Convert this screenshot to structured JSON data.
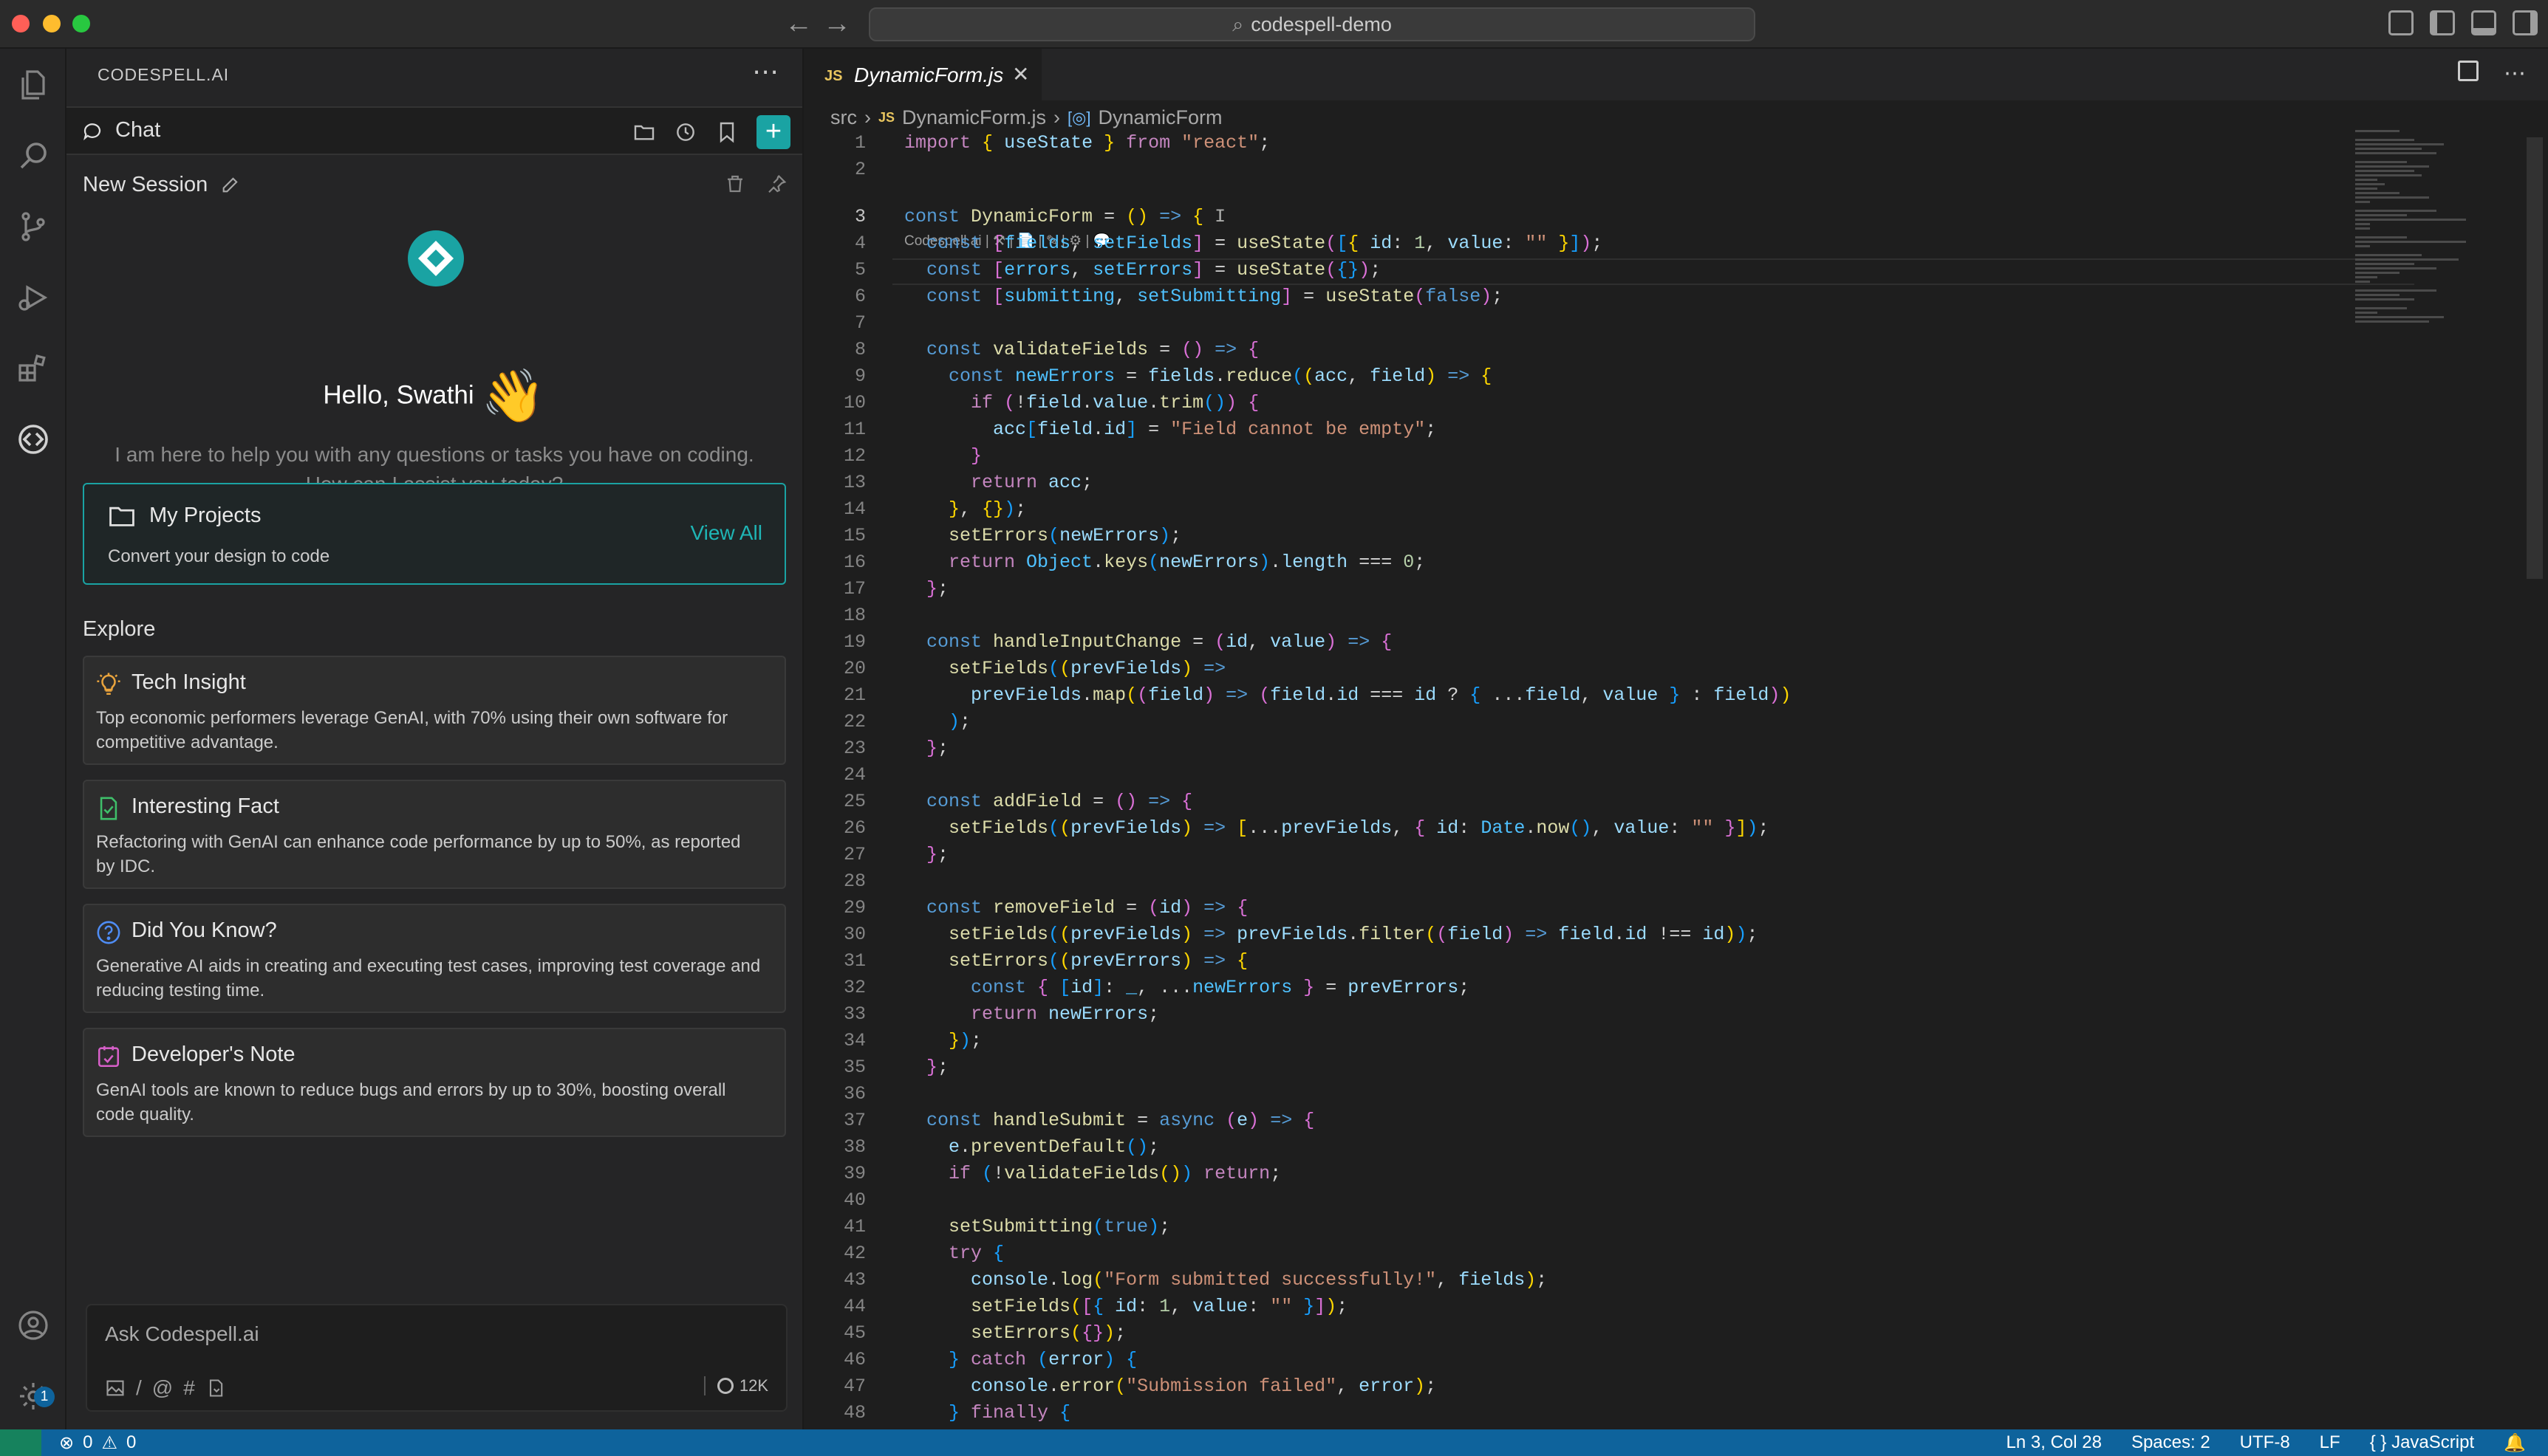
{
  "titlebar": {
    "search": "codespell-demo"
  },
  "sidebar": {
    "header": "CODESPELL.AI",
    "chat_label": "Chat",
    "session_title": "New Session",
    "greeting": "Hello, Swathi",
    "wave": "👋",
    "intro": "I am here to help you with any questions or tasks you have on coding. How can I assist you today?",
    "projects": {
      "title": "My Projects",
      "subtitle": "Convert your design to code",
      "view_all": "View All"
    },
    "explore_label": "Explore",
    "cards": [
      {
        "title": "Tech Insight",
        "body": "Top economic performers leverage GenAI, with 70% using their own software for competitive advantage.",
        "icon": "lightbulb-icon"
      },
      {
        "title": "Interesting Fact",
        "body": "Refactoring with GenAI can enhance code performance by up to 50%, as reported by IDC.",
        "icon": "check-file-icon"
      },
      {
        "title": "Did You Know?",
        "body": "Generative AI aids in creating and executing test cases, improving test coverage and reducing testing time.",
        "icon": "question-icon"
      },
      {
        "title": "Developer's Note",
        "body": "GenAI tools are known to reduce bugs and errors by up to 30%, boosting overall code quality.",
        "icon": "note-icon"
      }
    ],
    "ask_placeholder": "Ask Codespell.ai",
    "tokens": "12K"
  },
  "activity": {
    "settings_badge": "1"
  },
  "editor": {
    "tab_lang": "JS",
    "tab_name": "DynamicForm.js",
    "breadcrumb": {
      "folder": "src",
      "lang": "JS",
      "file": "DynamicForm.js",
      "symbol": "DynamicForm"
    },
    "codelens": "Codespell.ai | ⚒ | 📄 | ✎ | ⚙ | 💬",
    "lines": [
      "1",
      "2",
      "3",
      "4",
      "5",
      "6",
      "7",
      "8",
      "9",
      "10",
      "11",
      "12",
      "13",
      "14",
      "15",
      "16",
      "17",
      "18",
      "19",
      "20",
      "21",
      "22",
      "23",
      "24",
      "25",
      "26",
      "27",
      "28",
      "29",
      "30",
      "31",
      "32",
      "33",
      "34",
      "35",
      "36",
      "37",
      "38",
      "39",
      "40",
      "41",
      "42",
      "43",
      "44",
      "45",
      "46",
      "47",
      "48"
    ]
  },
  "statusbar": {
    "errors": "0",
    "warnings": "0",
    "position": "Ln 3, Col 28",
    "spaces": "Spaces: 2",
    "encoding": "UTF-8",
    "eol": "LF",
    "language": "JavaScript"
  },
  "colors": {
    "accent": "#1aa3a3",
    "status": "#0e639c"
  }
}
